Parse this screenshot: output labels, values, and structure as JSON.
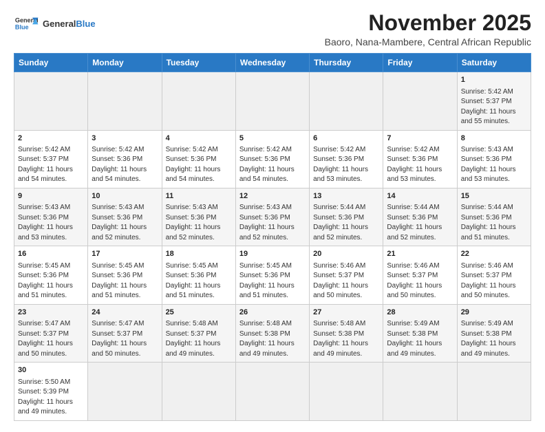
{
  "header": {
    "logo_text_general": "General",
    "logo_text_blue": "Blue",
    "title": "November 2025",
    "subtitle": "Baoro, Nana-Mambere, Central African Republic"
  },
  "calendar": {
    "days_of_week": [
      "Sunday",
      "Monday",
      "Tuesday",
      "Wednesday",
      "Thursday",
      "Friday",
      "Saturday"
    ],
    "weeks": [
      [
        {
          "day": "",
          "info": ""
        },
        {
          "day": "",
          "info": ""
        },
        {
          "day": "",
          "info": ""
        },
        {
          "day": "",
          "info": ""
        },
        {
          "day": "",
          "info": ""
        },
        {
          "day": "",
          "info": ""
        },
        {
          "day": "1",
          "info": "Sunrise: 5:42 AM\nSunset: 5:37 PM\nDaylight: 11 hours\nand 55 minutes."
        }
      ],
      [
        {
          "day": "2",
          "info": "Sunrise: 5:42 AM\nSunset: 5:37 PM\nDaylight: 11 hours\nand 54 minutes."
        },
        {
          "day": "3",
          "info": "Sunrise: 5:42 AM\nSunset: 5:36 PM\nDaylight: 11 hours\nand 54 minutes."
        },
        {
          "day": "4",
          "info": "Sunrise: 5:42 AM\nSunset: 5:36 PM\nDaylight: 11 hours\nand 54 minutes."
        },
        {
          "day": "5",
          "info": "Sunrise: 5:42 AM\nSunset: 5:36 PM\nDaylight: 11 hours\nand 54 minutes."
        },
        {
          "day": "6",
          "info": "Sunrise: 5:42 AM\nSunset: 5:36 PM\nDaylight: 11 hours\nand 53 minutes."
        },
        {
          "day": "7",
          "info": "Sunrise: 5:42 AM\nSunset: 5:36 PM\nDaylight: 11 hours\nand 53 minutes."
        },
        {
          "day": "8",
          "info": "Sunrise: 5:43 AM\nSunset: 5:36 PM\nDaylight: 11 hours\nand 53 minutes."
        }
      ],
      [
        {
          "day": "9",
          "info": "Sunrise: 5:43 AM\nSunset: 5:36 PM\nDaylight: 11 hours\nand 53 minutes."
        },
        {
          "day": "10",
          "info": "Sunrise: 5:43 AM\nSunset: 5:36 PM\nDaylight: 11 hours\nand 52 minutes."
        },
        {
          "day": "11",
          "info": "Sunrise: 5:43 AM\nSunset: 5:36 PM\nDaylight: 11 hours\nand 52 minutes."
        },
        {
          "day": "12",
          "info": "Sunrise: 5:43 AM\nSunset: 5:36 PM\nDaylight: 11 hours\nand 52 minutes."
        },
        {
          "day": "13",
          "info": "Sunrise: 5:44 AM\nSunset: 5:36 PM\nDaylight: 11 hours\nand 52 minutes."
        },
        {
          "day": "14",
          "info": "Sunrise: 5:44 AM\nSunset: 5:36 PM\nDaylight: 11 hours\nand 52 minutes."
        },
        {
          "day": "15",
          "info": "Sunrise: 5:44 AM\nSunset: 5:36 PM\nDaylight: 11 hours\nand 51 minutes."
        }
      ],
      [
        {
          "day": "16",
          "info": "Sunrise: 5:45 AM\nSunset: 5:36 PM\nDaylight: 11 hours\nand 51 minutes."
        },
        {
          "day": "17",
          "info": "Sunrise: 5:45 AM\nSunset: 5:36 PM\nDaylight: 11 hours\nand 51 minutes."
        },
        {
          "day": "18",
          "info": "Sunrise: 5:45 AM\nSunset: 5:36 PM\nDaylight: 11 hours\nand 51 minutes."
        },
        {
          "day": "19",
          "info": "Sunrise: 5:45 AM\nSunset: 5:36 PM\nDaylight: 11 hours\nand 51 minutes."
        },
        {
          "day": "20",
          "info": "Sunrise: 5:46 AM\nSunset: 5:37 PM\nDaylight: 11 hours\nand 50 minutes."
        },
        {
          "day": "21",
          "info": "Sunrise: 5:46 AM\nSunset: 5:37 PM\nDaylight: 11 hours\nand 50 minutes."
        },
        {
          "day": "22",
          "info": "Sunrise: 5:46 AM\nSunset: 5:37 PM\nDaylight: 11 hours\nand 50 minutes."
        }
      ],
      [
        {
          "day": "23",
          "info": "Sunrise: 5:47 AM\nSunset: 5:37 PM\nDaylight: 11 hours\nand 50 minutes."
        },
        {
          "day": "24",
          "info": "Sunrise: 5:47 AM\nSunset: 5:37 PM\nDaylight: 11 hours\nand 50 minutes."
        },
        {
          "day": "25",
          "info": "Sunrise: 5:48 AM\nSunset: 5:37 PM\nDaylight: 11 hours\nand 49 minutes."
        },
        {
          "day": "26",
          "info": "Sunrise: 5:48 AM\nSunset: 5:38 PM\nDaylight: 11 hours\nand 49 minutes."
        },
        {
          "day": "27",
          "info": "Sunrise: 5:48 AM\nSunset: 5:38 PM\nDaylight: 11 hours\nand 49 minutes."
        },
        {
          "day": "28",
          "info": "Sunrise: 5:49 AM\nSunset: 5:38 PM\nDaylight: 11 hours\nand 49 minutes."
        },
        {
          "day": "29",
          "info": "Sunrise: 5:49 AM\nSunset: 5:38 PM\nDaylight: 11 hours\nand 49 minutes."
        }
      ],
      [
        {
          "day": "30",
          "info": "Sunrise: 5:50 AM\nSunset: 5:39 PM\nDaylight: 11 hours\nand 49 minutes."
        },
        {
          "day": "",
          "info": ""
        },
        {
          "day": "",
          "info": ""
        },
        {
          "day": "",
          "info": ""
        },
        {
          "day": "",
          "info": ""
        },
        {
          "day": "",
          "info": ""
        },
        {
          "day": "",
          "info": ""
        }
      ]
    ]
  }
}
